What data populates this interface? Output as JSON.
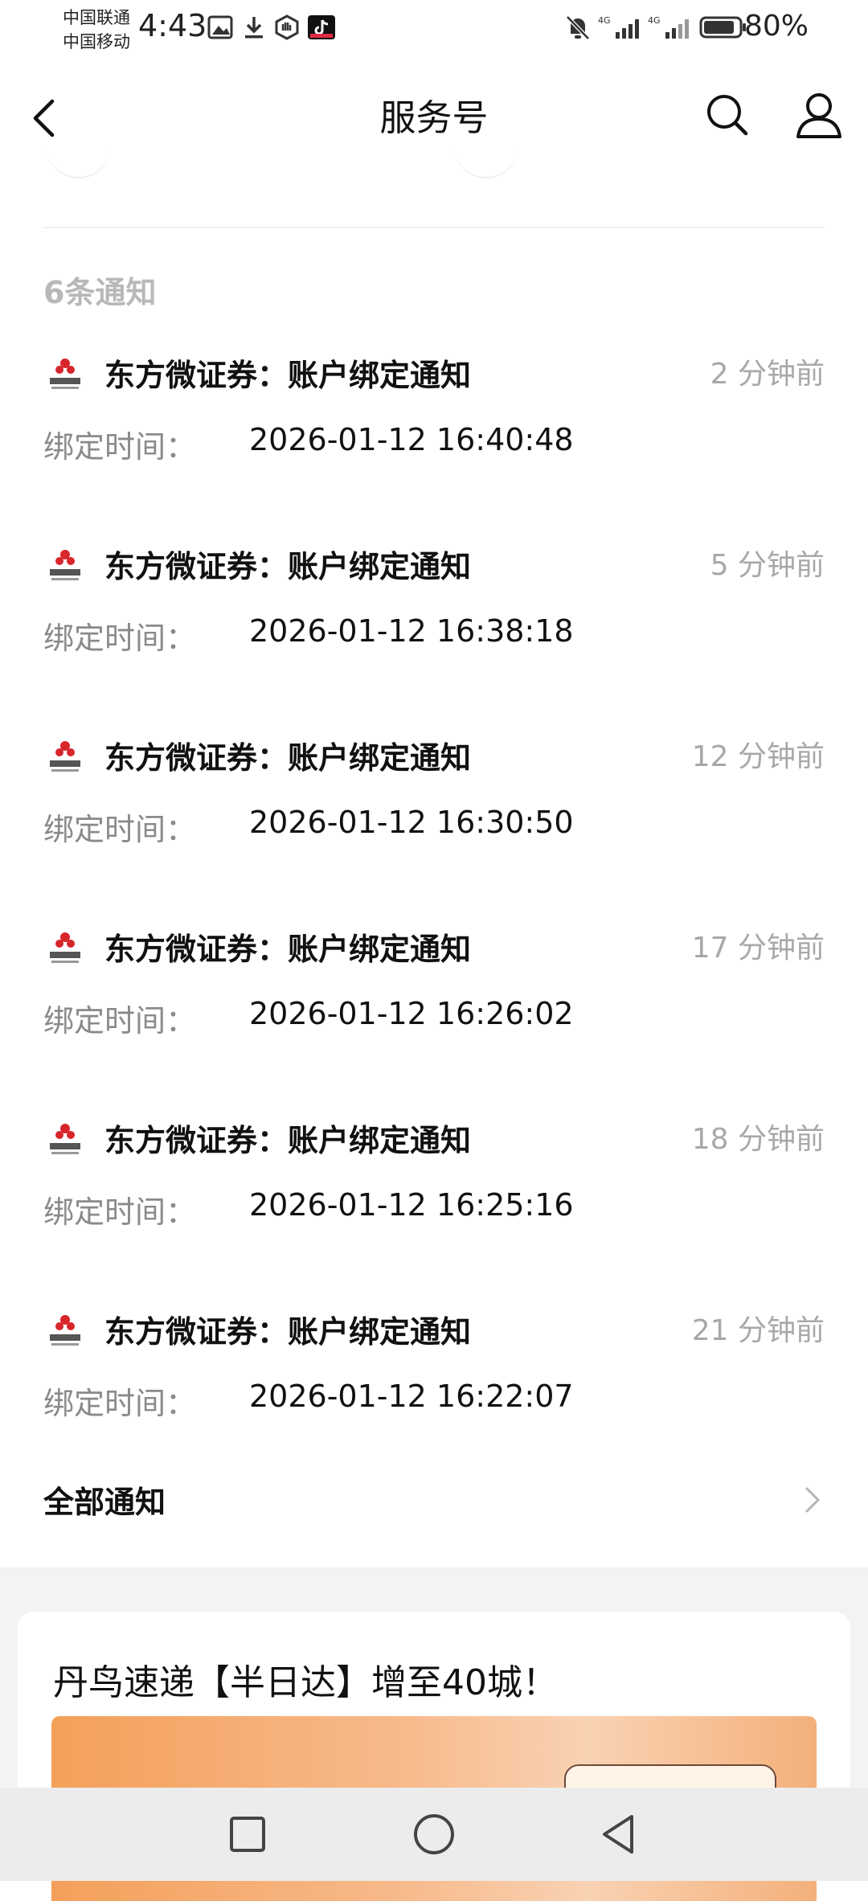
{
  "status_bar": {
    "carrier1": "中国联通",
    "carrier2": "中国移动",
    "time": "4:43",
    "battery": "80%",
    "signal_badge": "4G"
  },
  "header": {
    "title": "服务号"
  },
  "notices": {
    "count_label": "6条通知",
    "items": [
      {
        "title": "东方微证券：账户绑定通知",
        "time": "2 分钟前",
        "label": "绑定时间：",
        "value": "2026-01-12 16:40:48"
      },
      {
        "title": "东方微证券：账户绑定通知",
        "time": "5 分钟前",
        "label": "绑定时间：",
        "value": "2026-01-12 16:38:18"
      },
      {
        "title": "东方微证券：账户绑定通知",
        "time": "12 分钟前",
        "label": "绑定时间：",
        "value": "2026-01-12 16:30:50"
      },
      {
        "title": "东方微证券：账户绑定通知",
        "time": "17 分钟前",
        "label": "绑定时间：",
        "value": "2026-01-12 16:26:02"
      },
      {
        "title": "东方微证券：账户绑定通知",
        "time": "18 分钟前",
        "label": "绑定时间：",
        "value": "2026-01-12 16:25:16"
      },
      {
        "title": "东方微证券：账户绑定通知",
        "time": "21 分钟前",
        "label": "绑定时间：",
        "value": "2026-01-12 16:22:07"
      }
    ],
    "all_label": "全部通知"
  },
  "card": {
    "title": "丹鸟速递【半日达】增至40城！"
  },
  "colors": {
    "brand_logo": "#d7262b",
    "secondary_text": "#8a8a8a",
    "time_text": "#a8a8a8",
    "nav_bg": "#ececec"
  }
}
